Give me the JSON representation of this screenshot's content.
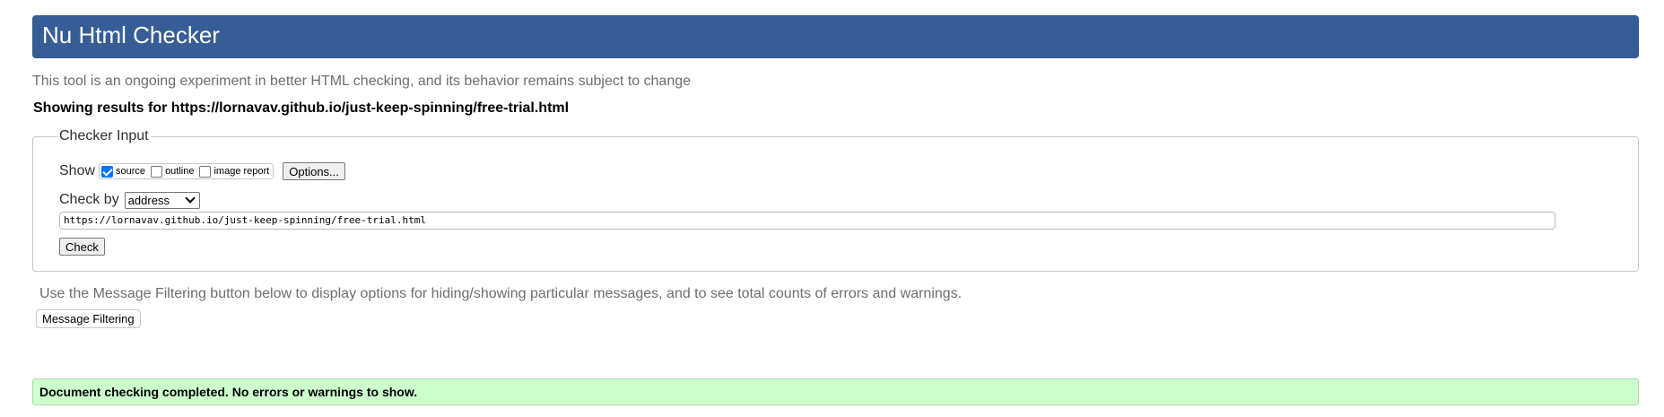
{
  "header": {
    "title": "Nu Html Checker"
  },
  "subtitle": "This tool is an ongoing experiment in better HTML checking, and its behavior remains subject to change",
  "showing_results": "Showing results for https://lornavav.github.io/just-keep-spinning/free-trial.html",
  "checker_input": {
    "legend": "Checker Input",
    "show_label": "Show",
    "options": [
      {
        "label": "source",
        "checked": true
      },
      {
        "label": "outline",
        "checked": false
      },
      {
        "label": "image report",
        "checked": false
      }
    ],
    "options_button": "Options...",
    "check_by_label": "Check by",
    "check_by_selected": "address",
    "url_value": "https://lornavav.github.io/just-keep-spinning/free-trial.html",
    "check_button": "Check"
  },
  "filter_info": "Use the Message Filtering button below to display options for hiding/showing particular messages, and to see total counts of errors and warnings.",
  "filter_button": "Message Filtering",
  "result_message": "Document checking completed. No errors or warnings to show.",
  "colors": {
    "header_bg": "#365d95",
    "success_bg": "#ccffcc",
    "checkbox_accent": "#0075ff"
  }
}
